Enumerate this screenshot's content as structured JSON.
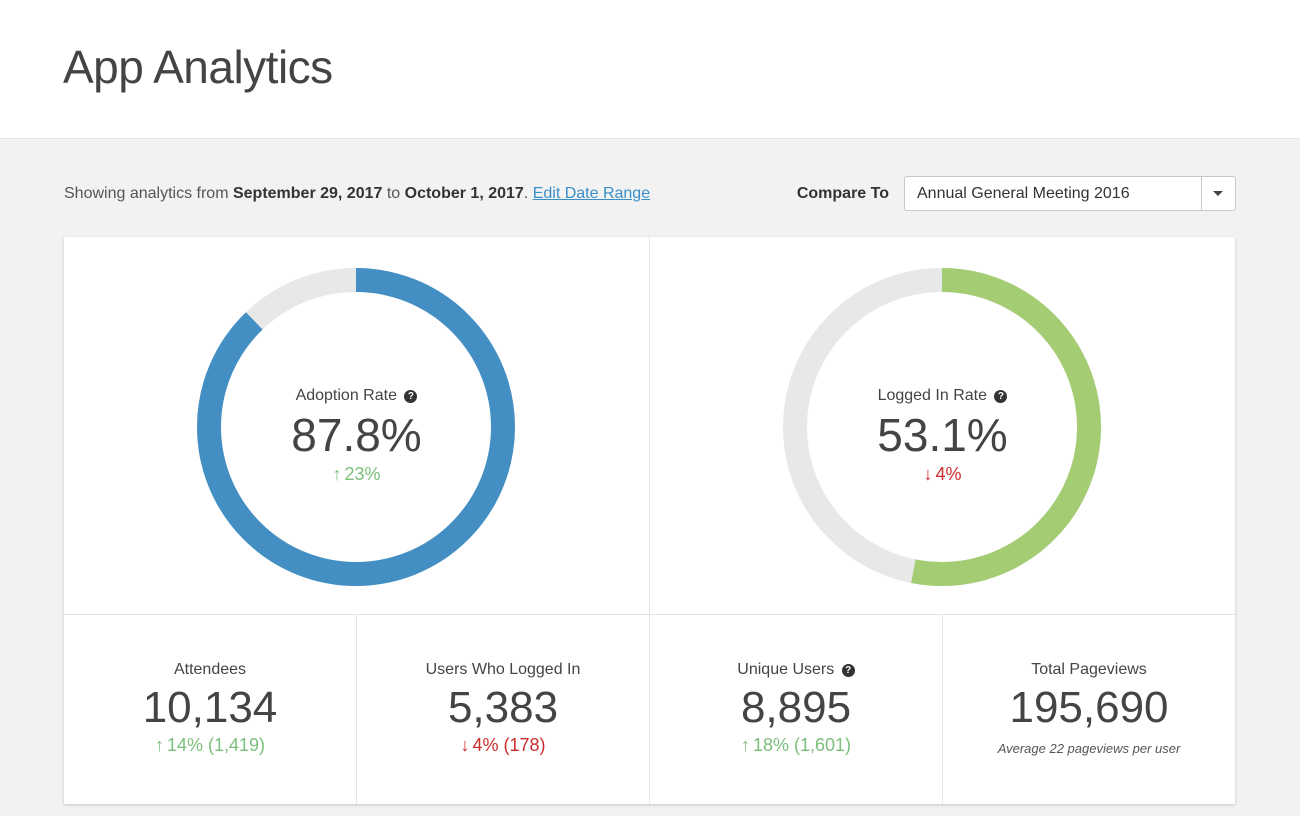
{
  "header": {
    "title": "App Analytics"
  },
  "toolbar": {
    "range_prefix": "Showing analytics from ",
    "range_start": "September 29, 2017",
    "range_mid": " to ",
    "range_end": "October 1, 2017",
    "range_suffix": ". ",
    "edit_link": "Edit Date Range",
    "compare_label": "Compare To",
    "compare_value": "Annual General Meeting 2016"
  },
  "colors": {
    "adoption": "#438fc4",
    "logged_in": "#a3cc73",
    "track": "#e8e8e8",
    "up": "#7bbf7a",
    "down": "#cc2d2d"
  },
  "donuts": {
    "adoption": {
      "label": "Adoption Rate",
      "value": "87.8%",
      "fraction": 0.878,
      "change": "23%",
      "direction": "up",
      "icon": "help-circle-icon"
    },
    "logged_in": {
      "label": "Logged In Rate",
      "value": "53.1%",
      "fraction": 0.531,
      "change": "4%",
      "direction": "down",
      "icon": "help-circle-icon"
    }
  },
  "stats": {
    "attendees": {
      "label": "Attendees",
      "value": "10,134",
      "change": "14% (1,419)",
      "direction": "up"
    },
    "users_logged_in": {
      "label": "Users Who Logged In",
      "value": "5,383",
      "change": "4% (178)",
      "direction": "down"
    },
    "unique_users": {
      "label": "Unique Users",
      "value": "8,895",
      "change": "18% (1,601)",
      "direction": "up"
    },
    "total_pageviews": {
      "label": "Total Pageviews",
      "value": "195,690",
      "note": "Average 22 pageviews per user"
    }
  }
}
